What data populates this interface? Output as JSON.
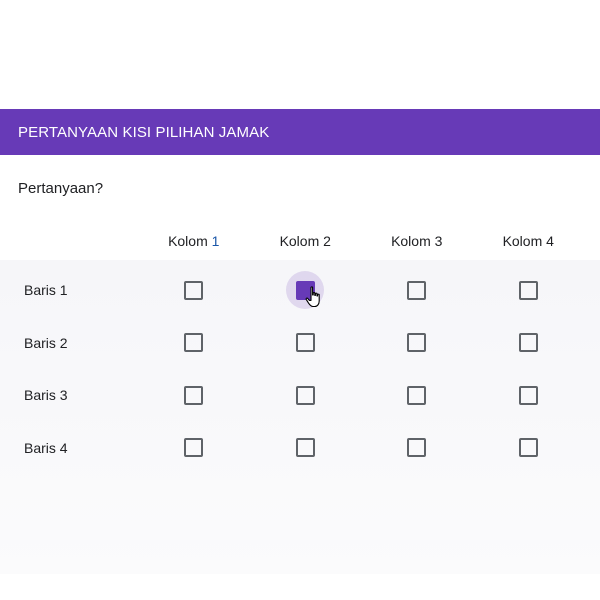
{
  "form": {
    "section_title": "PERTANYAAN KISI PILIHAN JAMAK",
    "question": "Pertanyaan?",
    "columns": [
      "Kolom ",
      "Kolom 2",
      "Kolom 3",
      "Kolom 4"
    ],
    "column_1_number": "1",
    "rows": [
      "Baris 1",
      "Baris 2",
      "Baris 3",
      "Baris 4"
    ]
  },
  "state": {
    "checked": [
      [
        false,
        true,
        false,
        false
      ],
      [
        false,
        false,
        false,
        false
      ],
      [
        false,
        false,
        false,
        false
      ],
      [
        false,
        false,
        false,
        false
      ]
    ]
  },
  "colors": {
    "accent": "#673ab7",
    "hover_ripple": "#e3dbef"
  }
}
